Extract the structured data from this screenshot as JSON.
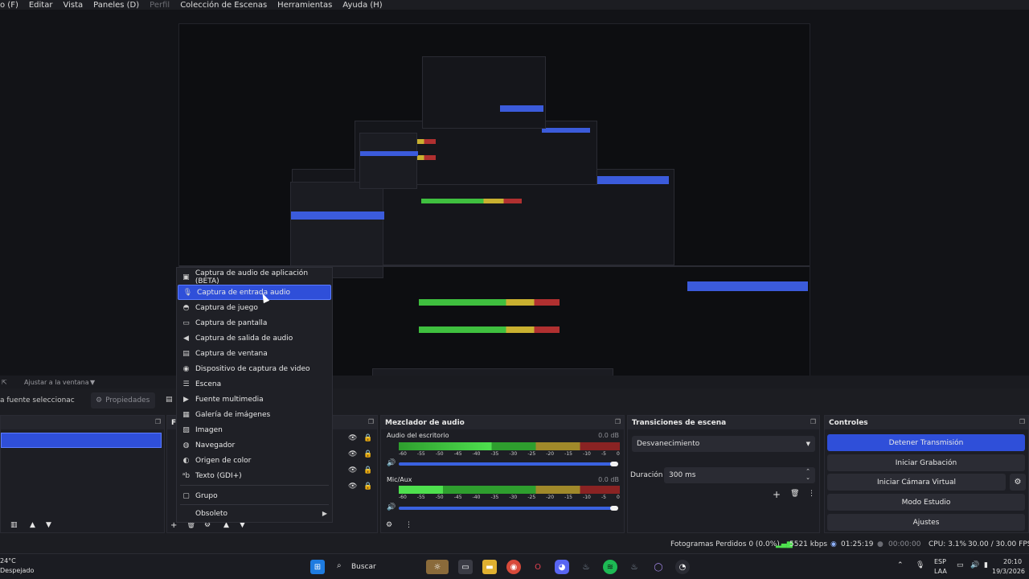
{
  "menubar": {
    "items": [
      "o (F)",
      "Editar",
      "Vista",
      "Paneles (D)",
      "Perfil",
      "Colección de Escenas",
      "Herramientas",
      "Ayuda (H)"
    ]
  },
  "context_menu": {
    "items": [
      {
        "label": "Captura de audio de aplicación (BETA)",
        "icon": "app-audio-icon"
      },
      {
        "label": "Captura de entrada audio",
        "icon": "microphone-icon"
      },
      {
        "label": "Captura de juego",
        "icon": "gamepad-icon"
      },
      {
        "label": "Captura de pantalla",
        "icon": "monitor-icon"
      },
      {
        "label": "Captura de salida de audio",
        "icon": "speaker-icon"
      },
      {
        "label": "Captura de ventana",
        "icon": "window-icon"
      },
      {
        "label": "Dispositivo de captura de video",
        "icon": "camera-icon"
      },
      {
        "label": "Escena",
        "icon": "list-icon"
      },
      {
        "label": "Fuente multimedia",
        "icon": "play-icon"
      },
      {
        "label": "Galería de imágenes",
        "icon": "gallery-icon"
      },
      {
        "label": "Imagen",
        "icon": "image-icon"
      },
      {
        "label": "Navegador",
        "icon": "globe-icon"
      },
      {
        "label": "Origen de color",
        "icon": "palette-icon"
      },
      {
        "label": "Texto (GDI+)",
        "icon": "text-icon"
      },
      {
        "label": "Grupo",
        "icon": "folder-icon"
      },
      {
        "label": "Obsoleto",
        "icon": ""
      }
    ],
    "selected_index": 1
  },
  "toolbar": {
    "fit_window": "Ajustar a la ventana",
    "no_source": "a fuente seleccionac",
    "properties": "Propiedades"
  },
  "mixer": {
    "title": "Mezclador de audio",
    "channels": [
      {
        "name": "Audio del escritorio",
        "db": "0.0 dB"
      },
      {
        "name": "Mic/Aux",
        "db": "0.0 dB"
      }
    ],
    "ticks": [
      "-60",
      "-55",
      "-50",
      "-45",
      "-40",
      "-35",
      "-30",
      "-25",
      "-20",
      "-15",
      "-10",
      "-5",
      "0"
    ]
  },
  "transitions": {
    "title": "Transiciones de escena",
    "selected": "Desvanecimiento",
    "duration_label": "Duración",
    "duration_value": "300 ms"
  },
  "controls": {
    "title": "Controles",
    "buttons": [
      "Detener Transmisión",
      "Iniciar Grabación",
      "Iniciar Cámara Virtual",
      "Modo Estudio",
      "Ajustes"
    ]
  },
  "docks": {
    "sources_title": "F"
  },
  "status": {
    "dropped": "Fotogramas Perdidos 0 (0.0%)",
    "bitrate": "5521 kbps",
    "live_time": "01:25:19",
    "rec_time": "00:00:00",
    "cpu": "CPU: 3.1%",
    "fps": "30.00 / 30.00 FPS"
  },
  "taskbar": {
    "weather_temp": "24°C",
    "weather_desc": "Despejado",
    "search": "Buscar",
    "lang_top": "ESP",
    "lang_bottom": "LAA",
    "time": "20:10",
    "date": "19/3/2026"
  },
  "colors": {
    "accent": "#2f4fd9",
    "meter_green": "#4ee04e",
    "meter_yellow": "#c9b030",
    "meter_red": "#8a2323"
  }
}
